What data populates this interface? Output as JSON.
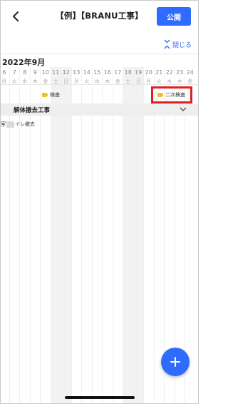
{
  "header": {
    "back_icon": "chevron-left-icon",
    "title": "【例】【BRANU工事】",
    "publish_label": "公開"
  },
  "collapse": {
    "label": "閉じる",
    "icon": "collapse-arrows-icon"
  },
  "calendar": {
    "month": "2022年9月",
    "days": [
      {
        "num": "6",
        "wd": "月"
      },
      {
        "num": "7",
        "wd": "火"
      },
      {
        "num": "8",
        "wd": "水"
      },
      {
        "num": "9",
        "wd": "木"
      },
      {
        "num": "10",
        "wd": "金"
      },
      {
        "num": "11",
        "wd": "土"
      },
      {
        "num": "12",
        "wd": "日"
      },
      {
        "num": "13",
        "wd": "月"
      },
      {
        "num": "14",
        "wd": "火"
      },
      {
        "num": "15",
        "wd": "水"
      },
      {
        "num": "16",
        "wd": "木"
      },
      {
        "num": "17",
        "wd": "金"
      },
      {
        "num": "18",
        "wd": "土"
      },
      {
        "num": "19",
        "wd": "日"
      },
      {
        "num": "20",
        "wd": "月"
      },
      {
        "num": "21",
        "wd": "火"
      },
      {
        "num": "22",
        "wd": "水"
      },
      {
        "num": "23",
        "wd": "木"
      },
      {
        "num": "24",
        "wd": "金"
      }
    ]
  },
  "milestones": [
    {
      "label": "検査"
    },
    {
      "label": "二次検査"
    }
  ],
  "group": {
    "label": "解体撤去工事"
  },
  "task": {
    "prefix": "室",
    "suffix": "イレ撤去"
  },
  "colors": {
    "accent": "#2f6bff",
    "flag": "#f0c020",
    "highlight": "#e02020"
  },
  "fab_icon": "plus-icon"
}
